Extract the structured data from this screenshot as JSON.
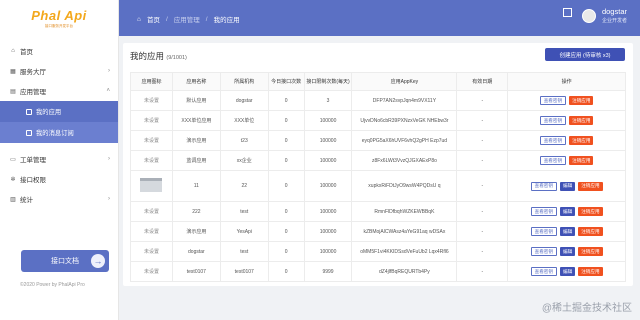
{
  "logo": {
    "text": "Phal Api",
    "sub": "接口服务开发平台"
  },
  "nav": {
    "home": "首页",
    "service": "服务大厅",
    "app_mgmt": "应用管理",
    "my_apps": "我的应用",
    "my_subs": "我的消息订阅",
    "tickets": "工单管理",
    "api_perm": "接口权限",
    "stats": "统计"
  },
  "doc_button": "接口文档",
  "powered": "©2020 Power by PhalApi Pro",
  "breadcrumb": {
    "home": "首页",
    "mgmt": "应用管理",
    "current": "我的应用"
  },
  "user": {
    "name": "dogstar",
    "role": "企业开发者"
  },
  "card": {
    "title": "我的应用",
    "count": "(9/1001)",
    "create_label": "创建应用 (待审核 x3)"
  },
  "table": {
    "headers": [
      "应用图标",
      "应用名称",
      "所属机构",
      "今日接口次数",
      "接口限制次数(每天)",
      "应用AppKey",
      "有效日期",
      "操作"
    ],
    "rows": [
      {
        "icon": "未设置",
        "name": "默认应用",
        "org": "dogstar",
        "today": "0",
        "limit": "3",
        "appkey": "DFP7AN2svpJqn4m9VX11Y",
        "date": "-",
        "ops": [
          "查看密钥",
          "注销应用"
        ]
      },
      {
        "icon": "未设置",
        "name": "XXX单位应用",
        "org": "XXX单位",
        "today": "0",
        "limit": "100000",
        "appkey": "UjvvDNo6cbR39PXNzxVeGK NHEbw3r",
        "date": "-",
        "ops": [
          "查看密钥",
          "注销应用"
        ]
      },
      {
        "icon": "未设置",
        "name": "演示应用",
        "org": "t23",
        "today": "0",
        "limit": "100000",
        "appkey": "eyq0PG5aX6hUVF6vhQ2gPH Ezp7ud",
        "date": "-",
        "ops": [
          "查看密钥",
          "注销应用"
        ]
      },
      {
        "icon": "未设置",
        "name": "蓝调应用",
        "org": "xx企业",
        "today": "0",
        "limit": "100000",
        "appkey": "z8Fx6LWt3VvzQJGXAExP8o",
        "date": "-",
        "ops": [
          "查看密钥",
          "注销应用"
        ]
      },
      {
        "icon": "",
        "name": "11",
        "org": "22",
        "today": "0",
        "limit": "100000",
        "appkey": "xupkxRiFDtJyO9wsW4PQDsU q",
        "date": "-",
        "ops": [
          "查看密钥",
          "编辑",
          "注销应用"
        ]
      },
      {
        "icon": "未设置",
        "name": "222",
        "org": "test",
        "today": "0",
        "limit": "100000",
        "appkey": "RmnFlDfbqhWZKEWBBqK",
        "date": "-",
        "ops": [
          "查看密钥",
          "编辑",
          "注销应用"
        ]
      },
      {
        "icon": "未设置",
        "name": "演示应用",
        "org": "YesApi",
        "today": "0",
        "limit": "100000",
        "appkey": "kZBMojAlCWAsz4aYeG91aq wDSAx",
        "date": "-",
        "ops": [
          "查看密钥",
          "编辑",
          "注销应用"
        ]
      },
      {
        "icon": "未设置",
        "name": "dogstar",
        "org": "test",
        "today": "0",
        "limit": "100000",
        "appkey": "oMM5F1vi4KKIDSsdVeFuUb2 Lqx4Rfl6",
        "date": "-",
        "ops": [
          "查看密钥",
          "编辑",
          "注销应用"
        ]
      },
      {
        "icon": "未设置",
        "name": "test0107",
        "org": "test0107",
        "today": "0",
        "limit": "9999",
        "appkey": "dZ4jlfBqREQURTb4Py",
        "date": "-",
        "ops": [
          "查看密钥",
          "编辑",
          "注销应用"
        ]
      }
    ]
  },
  "watermark": "@稀土掘金技术社区"
}
